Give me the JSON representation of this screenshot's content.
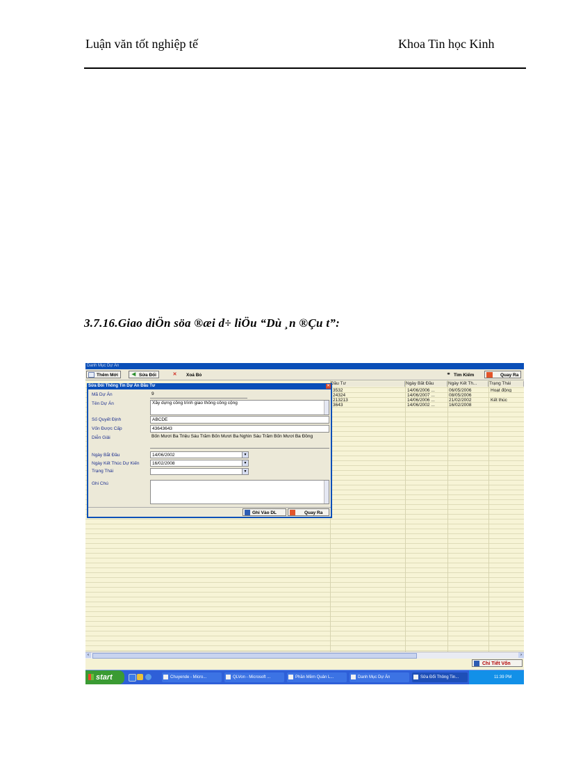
{
  "header": {
    "left": "Luận văn tốt nghiệp tế",
    "right": "Khoa Tin học Kinh"
  },
  "caption": "3.7.16.Giao diÖn söa ®æi d÷ liÖu “Dù ¸n ®Çu t”:",
  "app": {
    "window_title": "Danh Mục Dự Án",
    "toolbar": {
      "add": "Thêm Mới",
      "edit": "Sửa Đổi",
      "delete": "Xoá Bỏ",
      "search": "Tìm Kiếm",
      "back": "Quay Ra"
    },
    "columns": [
      "Đầu Tư",
      "Ngày Bắt Đầu",
      "Ngày Kết Th...",
      "Trạng Thái"
    ],
    "rows": [
      [
        "3532",
        "14/06/2006 ...",
        "06/05/2006",
        "Hoạt động"
      ],
      [
        "24324",
        "14/06/2007 ...",
        "08/05/2006",
        ""
      ],
      [
        "213213",
        "14/06/2006 ...",
        "21/02/2002",
        "Kết thúc"
      ],
      [
        "3643",
        "14/06/2002 ...",
        "16/02/2008",
        ""
      ]
    ],
    "detail_button": "Chi Tiết Vốn"
  },
  "dialog": {
    "title": "Sửa Đổi Thông Tin Dự Án Đầu Tư",
    "fields": {
      "ma_du_an": {
        "label": "Mã Dự Án",
        "value": "9"
      },
      "ten_du_an": {
        "label": "Tên Dự Án",
        "value": "Xây dựng công trình giao thông công cộng"
      },
      "so_quyet_dinh": {
        "label": "Số Quyết Định",
        "value": "ABCDE"
      },
      "von_duoc_cap": {
        "label": "Vốn Được Cấp",
        "value": "43643643"
      },
      "dien_giai": {
        "label": "Diễn Giải",
        "value": "Bốn Mươi Ba Triệu Sáu Trăm Bốn Mươi Ba Nghìn Sáu Trăm Bốn Mươi Ba Đồng"
      },
      "ngay_bat_dau": {
        "label": "Ngày Bắt Đầu",
        "value": "14/06/2002"
      },
      "ngay_ket_thuc": {
        "label": "Ngày Kết Thúc Dự Kiến",
        "value": "16/02/2008"
      },
      "trang_thai": {
        "label": "Trạng Thái",
        "value": ""
      },
      "ghi_chu": {
        "label": "Ghi Chú",
        "value": ""
      }
    },
    "save": "Ghi Vào DL",
    "back": "Quay Ra"
  },
  "taskbar": {
    "start": "start",
    "tasks": [
      "Chuyende - Micro...",
      "QLVon - Microsoft ...",
      "Phần Mềm Quản L...",
      "Danh Mục Dự Án",
      "Sửa Đổi Thông Tin..."
    ],
    "clock": "11:39 PM"
  }
}
